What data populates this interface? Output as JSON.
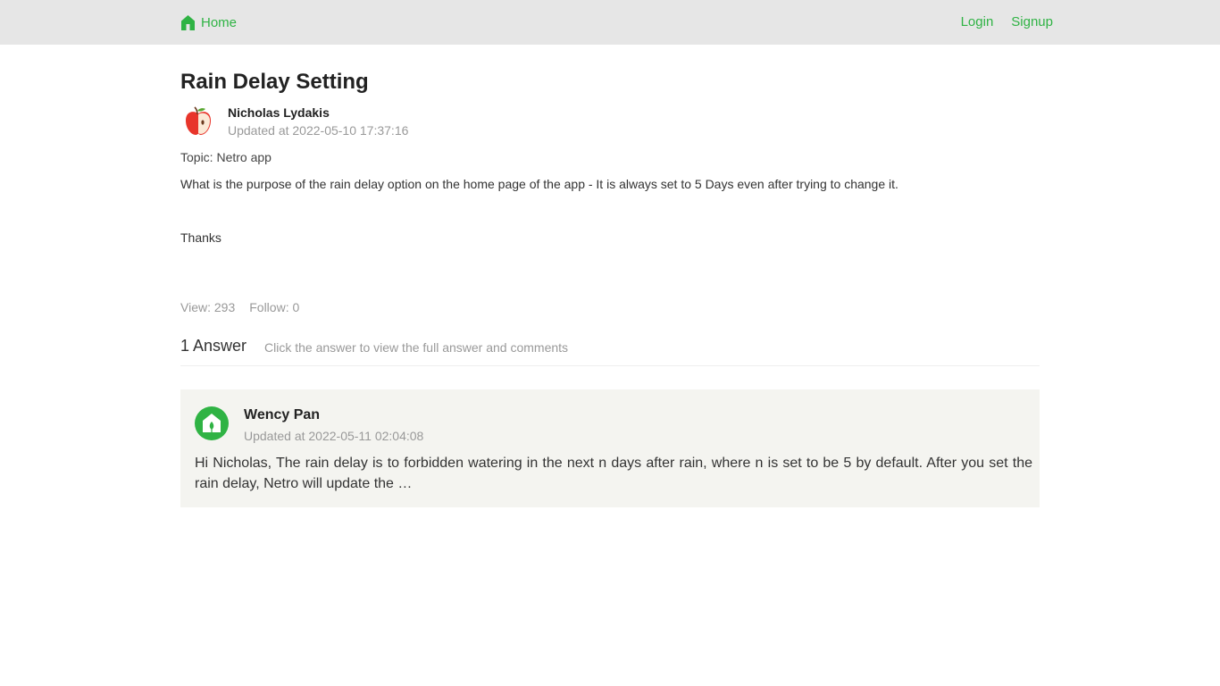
{
  "nav": {
    "home_label": "Home",
    "login_label": "Login",
    "signup_label": "Signup"
  },
  "question": {
    "title": "Rain Delay Setting",
    "author": "Nicholas Lydakis",
    "updated": "Updated at 2022-05-10 17:37:16",
    "topic": "Topic: Netro app",
    "body": [
      "What is the purpose of the rain delay option on the home page of the app - It is always set to 5 Days even after trying to change it.",
      "Thanks"
    ],
    "views": "View: 293",
    "follows": "Follow: 0"
  },
  "answers": {
    "count_label": "1 Answer",
    "hint": "Click the answer to view the full answer and comments",
    "items": [
      {
        "author": "Wency Pan",
        "updated": "Updated at 2022-05-11 02:04:08",
        "excerpt": "Hi Nicholas, The rain delay is to forbidden watering in the next n days after rain, where n is set to be 5 by default. After you set the rain delay, Netro will update the …"
      }
    ]
  },
  "icons": {
    "home": "home-icon",
    "author_avatar": "apple-avatar",
    "answer_avatar": "house-avatar"
  },
  "colors": {
    "accent": "#2fb344",
    "topbar": "#e6e6e6",
    "card": "#f4f4f0"
  }
}
